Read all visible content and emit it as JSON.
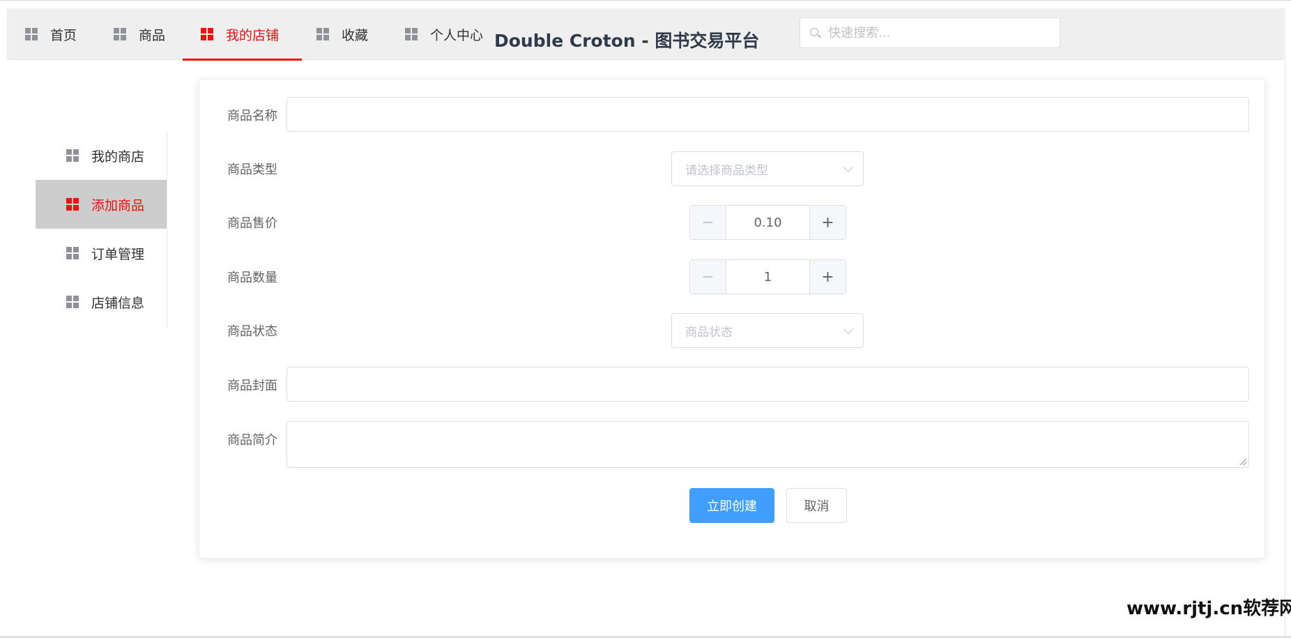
{
  "header": {
    "nav": [
      {
        "label": "首页",
        "icon": "grid-icon"
      },
      {
        "label": "商品",
        "icon": "grid-icon"
      },
      {
        "label": "我的店铺",
        "icon": "grid-icon",
        "active": true
      },
      {
        "label": "收藏",
        "icon": "grid-icon"
      },
      {
        "label": "个人中心",
        "icon": "grid-icon"
      }
    ],
    "brand": "Double Croton - 图书交易平台",
    "search_placeholder": "快速搜索..."
  },
  "sidebar": {
    "items": [
      {
        "label": "我的商店",
        "icon": "grid-icon"
      },
      {
        "label": "添加商品",
        "icon": "grid-icon",
        "active": true
      },
      {
        "label": "订单管理",
        "icon": "grid-icon"
      },
      {
        "label": "店铺信息",
        "icon": "grid-icon"
      }
    ]
  },
  "form": {
    "name_label": "商品名称",
    "name_value": "",
    "type_label": "商品类型",
    "type_placeholder": "请选择商品类型",
    "price_label": "商品售价",
    "price_value": "0.10",
    "quantity_label": "商品数量",
    "quantity_value": "1",
    "status_label": "商品状态",
    "status_placeholder": "商品状态",
    "cover_label": "商品封面",
    "cover_value": "",
    "intro_label": "商品简介",
    "intro_value": "",
    "minus_symbol": "−",
    "plus_symbol": "+",
    "submit_label": "立即创建",
    "cancel_label": "取消"
  },
  "watermark": "www.rjtj.cn软荐网",
  "colors": {
    "accent_red": "#f01010",
    "primary_blue": "#409eff",
    "header_bg": "#efefef",
    "sidebar_active_bg": "#cdcdcd"
  }
}
